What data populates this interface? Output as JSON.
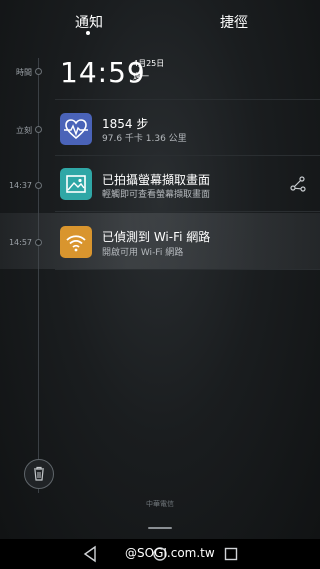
{
  "tabs": [
    {
      "label": "通知"
    },
    {
      "label": "捷徑"
    }
  ],
  "timeline": {
    "now_label": "時間",
    "recent_label": "立刻",
    "clock": "14:59",
    "date": "4月25日",
    "weekday": "週一"
  },
  "notifications": [
    {
      "time": "立刻",
      "title": "1854 步",
      "subtitle": "97.6 千卡    1.36 公里",
      "icon": "health-heart-icon"
    },
    {
      "time": "14:37",
      "title": "已拍攝螢幕擷取畫面",
      "subtitle": "輕觸即可查看螢幕擷取畫面",
      "icon": "image-icon"
    },
    {
      "time": "14:57",
      "title": "已偵測到 Wi-Fi 網路",
      "subtitle": "開啟可用 Wi-Fi 網路",
      "icon": "wifi-icon"
    }
  ],
  "carrier": "中華電信",
  "watermark": "@SOGI.com.tw",
  "colors": {
    "health_icon_bg": "#4a63b8",
    "image_icon_bg": "#2fa7a6",
    "wifi_icon_bg": "#d9952e"
  }
}
